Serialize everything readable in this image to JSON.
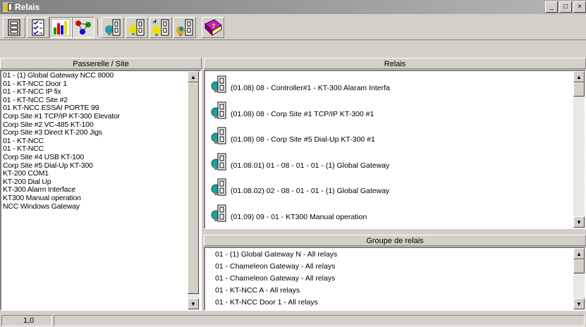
{
  "window": {
    "title": "Relais",
    "min_glyph": "_",
    "max_glyph": "□",
    "close_glyph": "×"
  },
  "toolbar": {
    "buttons": [
      {
        "name": "list-view-icon"
      },
      {
        "name": "checklist-icon"
      },
      {
        "name": "bar-chart-icon"
      },
      {
        "name": "network-icon"
      },
      {
        "name": "relay-bulb-icon"
      },
      {
        "name": "relay-on-icon"
      },
      {
        "name": "relay-pulse-icon"
      },
      {
        "name": "relay-group-icon"
      },
      {
        "name": "help-book-icon"
      }
    ]
  },
  "left_panel": {
    "header": "Passerelle / Site",
    "items": [
      "01 - (1)  Global Gateway NCC 8000",
      "01 - KT-NCC Door 1",
      "01 - KT-NCC IP fix",
      "01 - KT-NCC Site #2",
      "01 KT-NCC ESSAI PORTE 99",
      "Corp Site #1 TCP/IP KT-300 Elevator",
      "Corp Site #2 VC-485 KT-100",
      "Corp Site #3  Direct KT-200 Jigs",
      "01 - KT-NCC",
      "01 - KT-NCC",
      "Corp Site #4 USB KT-100",
      "Corp Site #5 Dial-Up KT-300",
      "KT-200  COM1",
      "KT-200 Dial Up",
      "KT-300 Alarm Interface",
      "KT300 Manual operation",
      "NCC Windows Gateway"
    ]
  },
  "relais_panel": {
    "header": "Relais",
    "items": [
      "(01.08) 08 - Controller#1 - KT-300 Alaram Interfa",
      "(01.08) 08 - Corp Site #1 TCP/IP KT-300 #1",
      "(01.08) 08 - Corp Site #5 Dial-Up KT-300 #1",
      "(01.08.01) 01 - 08 - 01 - 01 - (1)  Global Gateway",
      "(01.08.02) 02 - 08 - 01 - 01 - (1)  Global Gateway",
      "(01.09) 09 - 01 - KT300 Manual operation"
    ]
  },
  "groupe_panel": {
    "header": "Groupe de relais",
    "items": [
      "01 - (1)  Global Gateway N - All relays",
      "01 - Chameleon Gateway - All relays",
      "01 - Chameleon Gateway - All relays",
      "01 - KT-NCC A - All relays",
      "01 - KT-NCC Door 1 - All relays"
    ]
  },
  "statusbar": {
    "position": "1,0"
  },
  "colors": {
    "title_start": "#808080",
    "title_end": "#b5b5b5",
    "face": "#d4d0c8",
    "relay_bulb": "#20a0a0"
  }
}
